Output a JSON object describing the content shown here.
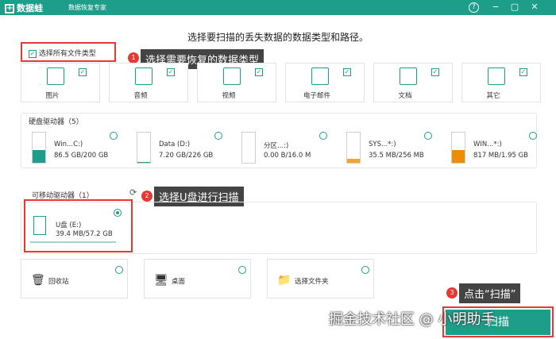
{
  "app": {
    "name": "数据蛙",
    "subtitle": "数据恢复专家",
    "help_glyph": "?",
    "min_glyph": "−",
    "restore_glyph": "▢",
    "close_glyph": "✕"
  },
  "headline": "选择要扫描的丢失数据的数据类型和路径。",
  "select_all": {
    "label": "选择所有文件类型",
    "checked": true
  },
  "callouts": [
    {
      "num": "1",
      "text": "选择需要恢复的数据类型"
    },
    {
      "num": "2",
      "text": "选择U盘进行扫描"
    },
    {
      "num": "3",
      "text": "点击“扫描”"
    }
  ],
  "file_types": [
    {
      "label": "图片",
      "icon": "image-icon",
      "checked": true
    },
    {
      "label": "音频",
      "icon": "audio-icon",
      "checked": true
    },
    {
      "label": "视频",
      "icon": "video-icon",
      "checked": true
    },
    {
      "label": "电子邮件",
      "icon": "email-icon",
      "checked": true
    },
    {
      "label": "文档",
      "icon": "document-icon",
      "checked": true
    },
    {
      "label": "其它",
      "icon": "other-icon",
      "checked": true
    }
  ],
  "hard_drives": {
    "title": "硬盘驱动器（5）",
    "items": [
      {
        "name": "Win...C:)",
        "size": "86.5 GB/200 GB",
        "used_fraction": 0.43,
        "color": "#1d9e8a"
      },
      {
        "name": "Data (D:)",
        "size": "7.20 GB/226 GB",
        "used_fraction": 0.03,
        "color": "#1d9e8a"
      },
      {
        "name": "分区...:)",
        "size": "0.00  B/16.0 M",
        "used_fraction": 0.0,
        "color": "#1d9e8a"
      },
      {
        "name": "SYS...*:)",
        "size": "35.5 MB/256 MB",
        "used_fraction": 0.14,
        "color": "#f5a623"
      },
      {
        "name": "WIN...*:)",
        "size": "817 MB/1.95 GB",
        "used_fraction": 0.42,
        "color": "#f08c00"
      }
    ]
  },
  "removable": {
    "title": "可移动驱动器（1）",
    "refresh_icon": "refresh-icon",
    "items": [
      {
        "name": "U盘 (E:)",
        "size": "39.4 MB/57.2 GB",
        "selected": true
      }
    ]
  },
  "locations": [
    {
      "label": "回收站",
      "icon": "recycle-bin-icon",
      "glyph": "🗑"
    },
    {
      "label": "桌面",
      "icon": "desktop-icon",
      "glyph": "🖥"
    },
    {
      "label": "选择文件夹",
      "icon": "folder-icon",
      "glyph": "📁"
    }
  ],
  "scan_button": {
    "label": "扫描"
  },
  "watermark": "掘金技术社区 @ 小明助手",
  "colors": {
    "accent": "#1d9e8a",
    "highlight": "#e53935"
  }
}
